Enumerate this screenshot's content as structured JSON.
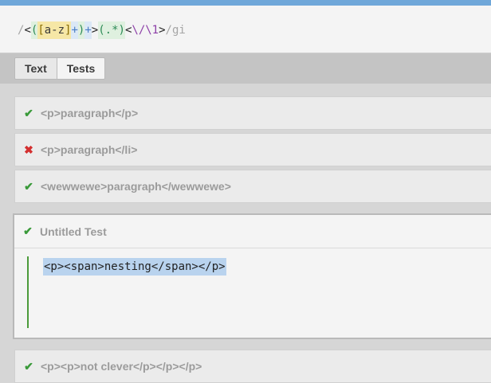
{
  "expression": {
    "tokens": [
      {
        "text": "/",
        "cls": "tok-delim"
      },
      {
        "text": "<",
        "cls": "tok-lit"
      },
      {
        "text": "(",
        "cls": "tok-group"
      },
      {
        "text": "[",
        "cls": "tok-setb"
      },
      {
        "text": "a-z",
        "cls": "tok-set"
      },
      {
        "text": "]",
        "cls": "tok-setb"
      },
      {
        "text": "+",
        "cls": "tok-quant"
      },
      {
        "text": ")",
        "cls": "tok-group"
      },
      {
        "text": "+",
        "cls": "tok-quant"
      },
      {
        "text": ">",
        "cls": "tok-lit"
      },
      {
        "text": "(.*)",
        "cls": "tok-any"
      },
      {
        "text": "<",
        "cls": "tok-lit"
      },
      {
        "text": "\\/",
        "cls": "tok-esc"
      },
      {
        "text": "\\1",
        "cls": "tok-esc"
      },
      {
        "text": ">",
        "cls": "tok-lit"
      },
      {
        "text": "/gi",
        "cls": "tok-flags"
      }
    ]
  },
  "tabs": [
    {
      "label": "Text",
      "active": false
    },
    {
      "label": "Tests",
      "active": true
    }
  ],
  "tests": [
    {
      "status": "pass",
      "label": "<p>paragraph</p>"
    },
    {
      "status": "fail",
      "label": "<p>paragraph</li>"
    },
    {
      "status": "pass",
      "label": "<wewwewe>paragraph</wewwewe>"
    },
    {
      "status": "pass",
      "label": "Untitled Test",
      "expanded": true,
      "content": "<p><span>nesting</span></p>"
    },
    {
      "status": "pass",
      "label": "<p><p>not clever</p></p></p>"
    }
  ],
  "icons": {
    "pass": "checkmark-icon",
    "fail": "cross-icon"
  },
  "colors": {
    "pass": "#3a9a3a",
    "fail": "#d32f2f",
    "accent": "#6fa7d9"
  }
}
